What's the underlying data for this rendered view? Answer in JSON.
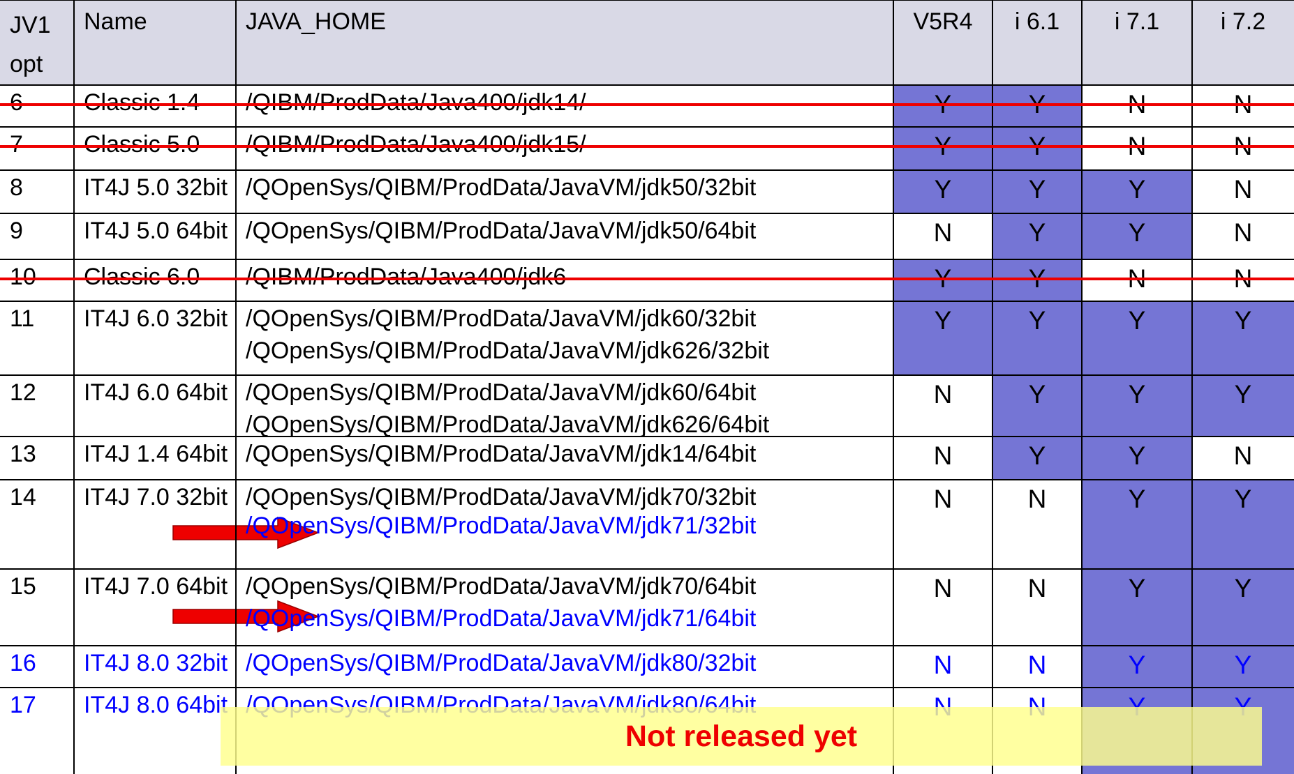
{
  "colors": {
    "header_bg": "#d9d9e6",
    "highlight_bg": "#7575d5",
    "text": "#000000",
    "new_text": "#0000ff",
    "strike": "#ee0000",
    "arrow": "#ee0000",
    "banner_bg": "#ffff8c",
    "banner_text": "#ee0000"
  },
  "table": {
    "headers": [
      [
        "JV1",
        "opt"
      ],
      [
        "Name"
      ],
      [
        "JAVA_HOME"
      ],
      [
        "V5R4"
      ],
      [
        "i 6.1"
      ],
      [
        "i 7.1"
      ],
      [
        "i 7.2"
      ]
    ],
    "rows": [
      {
        "opt": "6",
        "name": "Classic 1.4",
        "paths": [
          "/QIBM/ProdData/Java400/jdk14/"
        ],
        "v5r4": "Y",
        "i61": "Y",
        "i71": "N",
        "i72": "N",
        "hi": [
          1,
          1,
          0,
          0
        ],
        "struck": true,
        "arrow": false,
        "new_path": false,
        "new_row": false
      },
      {
        "opt": "7",
        "name": "Classic 5.0",
        "paths": [
          "/QIBM/ProdData/Java400/jdk15/"
        ],
        "v5r4": "Y",
        "i61": "Y",
        "i71": "N",
        "i72": "N",
        "hi": [
          1,
          1,
          0,
          0
        ],
        "struck": true,
        "arrow": false,
        "new_path": false,
        "new_row": false
      },
      {
        "opt": "8",
        "name": "IT4J 5.0 32bit",
        "paths": [
          "/QOpenSys/QIBM/ProdData/JavaVM/jdk50/32bit"
        ],
        "v5r4": "Y",
        "i61": "Y",
        "i71": "Y",
        "i72": "N",
        "hi": [
          1,
          1,
          1,
          0
        ],
        "struck": false,
        "arrow": false,
        "new_path": false,
        "new_row": false
      },
      {
        "opt": "9",
        "name": "IT4J 5.0 64bit",
        "paths": [
          "/QOpenSys/QIBM/ProdData/JavaVM/jdk50/64bit"
        ],
        "v5r4": "N",
        "i61": "Y",
        "i71": "Y",
        "i72": "N",
        "hi": [
          0,
          1,
          1,
          0
        ],
        "struck": false,
        "arrow": false,
        "new_path": false,
        "new_row": false
      },
      {
        "opt": "10",
        "name": "Classic 6.0",
        "paths": [
          "/QIBM/ProdData/Java400/jdk6"
        ],
        "v5r4": "Y",
        "i61": "Y",
        "i71": "N",
        "i72": "N",
        "hi": [
          1,
          1,
          0,
          0
        ],
        "struck": true,
        "arrow": false,
        "new_path": false,
        "new_row": false
      },
      {
        "opt": "11",
        "name": "IT4J 6.0 32bit",
        "paths": [
          "/QOpenSys/QIBM/ProdData/JavaVM/jdk60/32bit",
          "/QOpenSys/QIBM/ProdData/JavaVM/jdk626/32bit"
        ],
        "v5r4": "Y",
        "i61": "Y",
        "i71": "Y",
        "i72": "Y",
        "hi": [
          1,
          1,
          1,
          1
        ],
        "struck": false,
        "arrow": false,
        "new_path": false,
        "new_row": false
      },
      {
        "opt": "12",
        "name": "IT4J 6.0 64bit",
        "paths": [
          "/QOpenSys/QIBM/ProdData/JavaVM/jdk60/64bit",
          "/QOpenSys/QIBM/ProdData/JavaVM/jdk626/64bit"
        ],
        "v5r4": "N",
        "i61": "Y",
        "i71": "Y",
        "i72": "Y",
        "hi": [
          0,
          1,
          1,
          1
        ],
        "struck": false,
        "arrow": false,
        "new_path": false,
        "new_row": false
      },
      {
        "opt": "13",
        "name": "IT4J 1.4 64bit",
        "paths": [
          "/QOpenSys/QIBM/ProdData/JavaVM/jdk14/64bit"
        ],
        "v5r4": "N",
        "i61": "Y",
        "i71": "Y",
        "i72": "N",
        "hi": [
          0,
          1,
          1,
          0
        ],
        "struck": false,
        "arrow": false,
        "new_path": false,
        "new_row": false
      },
      {
        "opt": "14",
        "name": "IT4J 7.0 32bit",
        "paths": [
          "/QOpenSys/QIBM/ProdData/JavaVM/jdk70/32bit",
          "/QOpenSys/QIBM/ProdData/JavaVM/jdk71/32bit"
        ],
        "v5r4": "N",
        "i61": "N",
        "i71": "Y",
        "i72": "Y",
        "hi": [
          0,
          0,
          1,
          1
        ],
        "struck": false,
        "arrow": true,
        "new_path": true,
        "new_row": false
      },
      {
        "opt": "15",
        "name": "IT4J 7.0 64bit",
        "paths": [
          "/QOpenSys/QIBM/ProdData/JavaVM/jdk70/64bit",
          "/QOpenSys/QIBM/ProdData/JavaVM/jdk71/64bit"
        ],
        "v5r4": "N",
        "i61": "N",
        "i71": "Y",
        "i72": "Y",
        "hi": [
          0,
          0,
          1,
          1
        ],
        "struck": false,
        "arrow": true,
        "new_path": true,
        "new_row": false
      },
      {
        "opt": "16",
        "name": "IT4J 8.0 32bit",
        "paths": [
          "/QOpenSys/QIBM/ProdData/JavaVM/jdk80/32bit"
        ],
        "v5r4": "N",
        "i61": "N",
        "i71": "Y",
        "i72": "Y",
        "hi": [
          0,
          0,
          1,
          1
        ],
        "struck": false,
        "arrow": false,
        "new_path": false,
        "new_row": true
      },
      {
        "opt": "17",
        "name": "IT4J 8.0 64bit",
        "paths": [
          "/QOpenSys/QIBM/ProdData/JavaVM/jdk80/64bit"
        ],
        "v5r4": "N",
        "i61": "N",
        "i71": "Y",
        "i72": "Y",
        "hi": [
          0,
          0,
          1,
          1
        ],
        "struck": false,
        "arrow": false,
        "new_path": false,
        "new_row": true
      }
    ]
  },
  "banner": {
    "text": "Not released yet"
  }
}
